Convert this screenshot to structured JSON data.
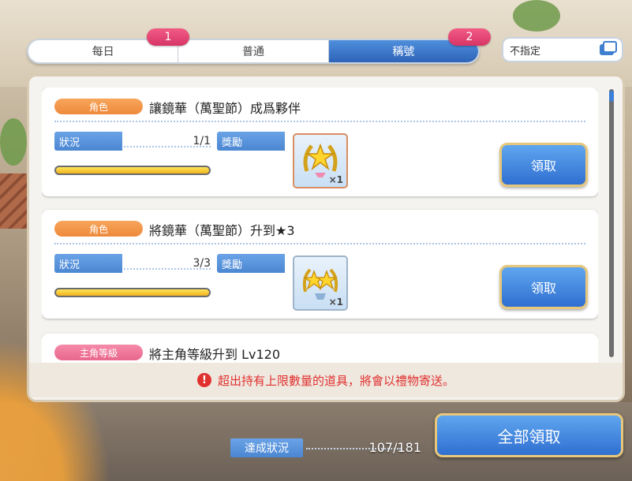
{
  "tabs": [
    {
      "label": "每日",
      "active": false
    },
    {
      "label": "普通",
      "active": false
    },
    {
      "label": "稱號",
      "active": true
    }
  ],
  "badges": {
    "daily": "1",
    "title": "2"
  },
  "filter": {
    "label": "不指定",
    "icon": "window-stack-icon"
  },
  "missions": [
    {
      "category": "角色",
      "title": "讓鏡華（萬聖節）成爲夥伴",
      "status_label": "狀況",
      "progress": "1/1",
      "progress_fraction": 1.0,
      "reward_label": "獎勵",
      "reward_icon": "gold-laurel-star-icon",
      "reward_qty": "×1",
      "claim_label": "領取"
    },
    {
      "category": "角色",
      "title": "將鏡華（萬聖節）升到★3",
      "status_label": "狀況",
      "progress": "3/3",
      "progress_fraction": 1.0,
      "reward_label": "獎勵",
      "reward_icon": "twin-star-laurel-icon",
      "reward_qty": "×1",
      "claim_label": "領取"
    },
    {
      "category": "主角等級",
      "title": "將主角等級升到 Lv120"
    }
  ],
  "notice": {
    "icon": "exclamation-icon",
    "text": "超出持有上限數量的道具，將會以禮物寄送。"
  },
  "achievement": {
    "label": "達成狀況",
    "value": "107/181"
  },
  "claim_all_label": "全部領取",
  "colors": {
    "accent_blue": "#3f7fd0",
    "badge_pink": "#e23e6f",
    "category_orange": "#f19a4a",
    "notice_red": "#e0312f"
  }
}
